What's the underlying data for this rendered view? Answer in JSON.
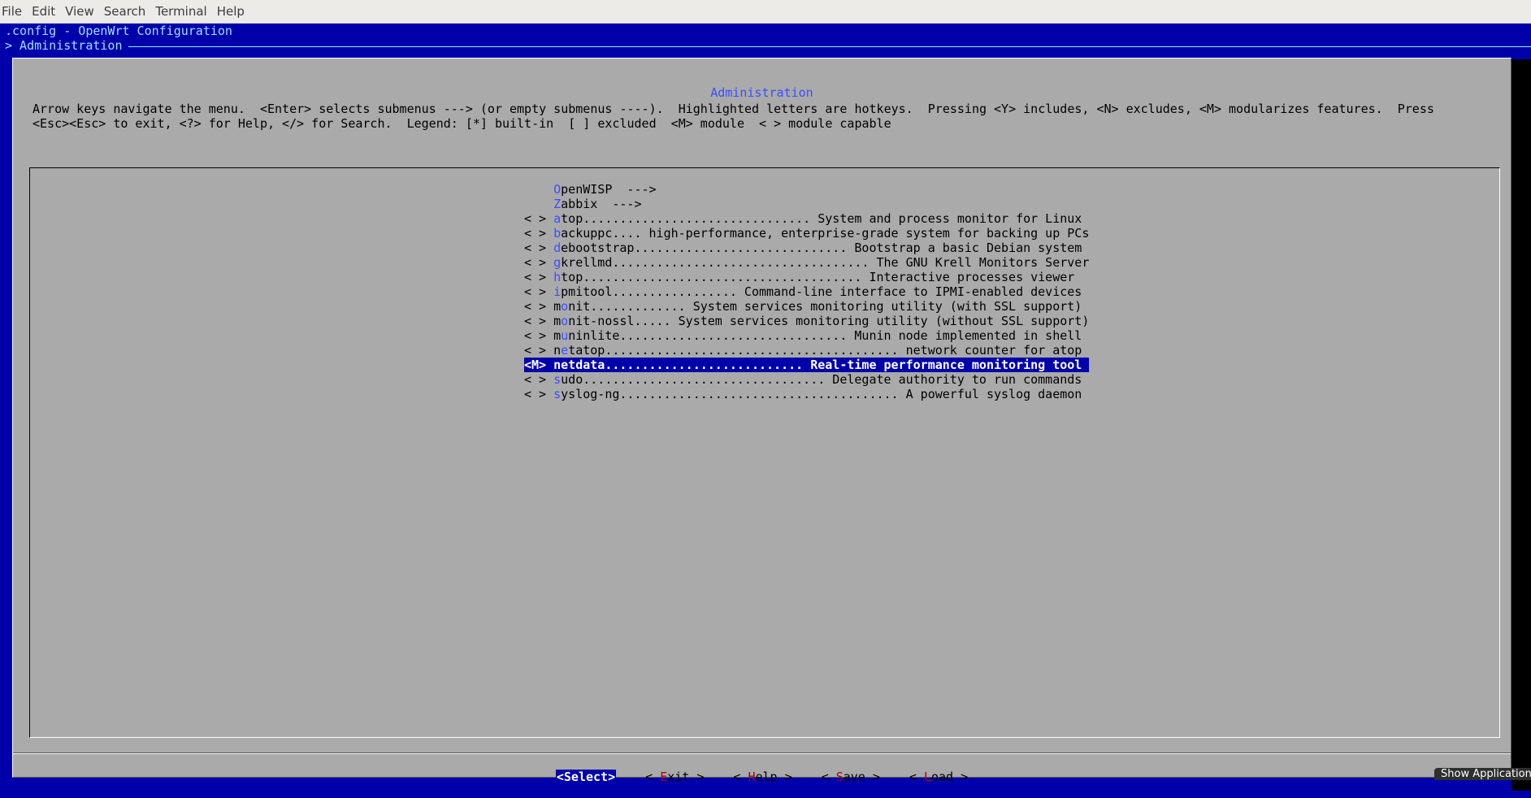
{
  "window_menu": [
    "File",
    "Edit",
    "View",
    "Search",
    "Terminal",
    "Help"
  ],
  "terminal": {
    "title_line": ".config - OpenWrt Configuration",
    "breadcrumb": "> Administration"
  },
  "dialog": {
    "title": "Administration",
    "help_line1": "Arrow keys navigate the menu.  <Enter> selects submenus ---> (or empty submenus ----).  Highlighted letters are hotkeys.  Pressing <Y> includes, <N> excludes, <M> modularizes features.  Press",
    "help_line2": "<Esc><Esc> to exit, <?> for Help, </> for Search.  Legend: [*] built-in  [ ] excluded  <M> module  < > module capable"
  },
  "menu_items": [
    {
      "prefix": "    ",
      "hotkey": "O",
      "rest": "penWISP  --->"
    },
    {
      "prefix": "    ",
      "hotkey": "Z",
      "rest": "abbix  --->"
    },
    {
      "prefix": "< > ",
      "hotkey": "a",
      "rest": "top............................... System and process monitor for Linux"
    },
    {
      "prefix": "< > ",
      "hotkey": "b",
      "rest": "ackuppc.... high-performance, enterprise-grade system for backing up PCs"
    },
    {
      "prefix": "< > ",
      "hotkey": "d",
      "rest": "ebootstrap............................. Bootstrap a basic Debian system"
    },
    {
      "prefix": "< > ",
      "hotkey": "g",
      "rest": "krellmd................................... The GNU Krell Monitors Server"
    },
    {
      "prefix": "< > ",
      "hotkey": "h",
      "pre": "",
      "rest": "top...................................... Interactive processes viewer"
    },
    {
      "prefix": "< > ",
      "hotkey": "i",
      "rest": "pmitool................. Command-line interface to IPMI-enabled devices"
    },
    {
      "prefix": "< > ",
      "pre": "m",
      "hotkey": "o",
      "rest": "nit............. System services monitoring utility (with SSL support)"
    },
    {
      "prefix": "< > ",
      "pre": "m",
      "hotkey": "o",
      "rest": "nit-nossl..... System services monitoring utility (without SSL support)"
    },
    {
      "prefix": "< > ",
      "pre": "m",
      "hotkey": "u",
      "rest": "ninlite............................... Munin node implemented in shell"
    },
    {
      "prefix": "< > ",
      "pre": "n",
      "hotkey": "e",
      "rest": "tatop........................................ network counter for atop"
    },
    {
      "prefix": "<M> ",
      "hotkey": "n",
      "rest": "etdata........................... Real-time performance monitoring tool",
      "selected": true
    },
    {
      "prefix": "< > ",
      "hotkey": "s",
      "rest": "udo................................. Delegate authority to run commands"
    },
    {
      "prefix": "< > ",
      "hotkey": "s",
      "rest": "yslog-ng...................................... A powerful syslog daemon"
    }
  ],
  "buttons": {
    "select": {
      "open": "<",
      "label": "Select",
      "close": ">"
    },
    "exit": {
      "open": "< ",
      "hotkey": "E",
      "rest": "xit",
      "close": " >"
    },
    "help": {
      "open": "< ",
      "hotkey": "H",
      "rest": "elp",
      "close": " >"
    },
    "save": {
      "open": "< ",
      "hotkey": "S",
      "rest": "ave",
      "close": " >"
    },
    "load": {
      "open": "< ",
      "hotkey": "L",
      "rest": "oad",
      "close": " >"
    }
  },
  "notification": "Show Applications",
  "colors": {
    "terminal_bg": "#0000aa",
    "dialog_bg": "#aaaaaa",
    "hotkey": "#3a4fff",
    "button_hotkey": "#aa0000"
  }
}
